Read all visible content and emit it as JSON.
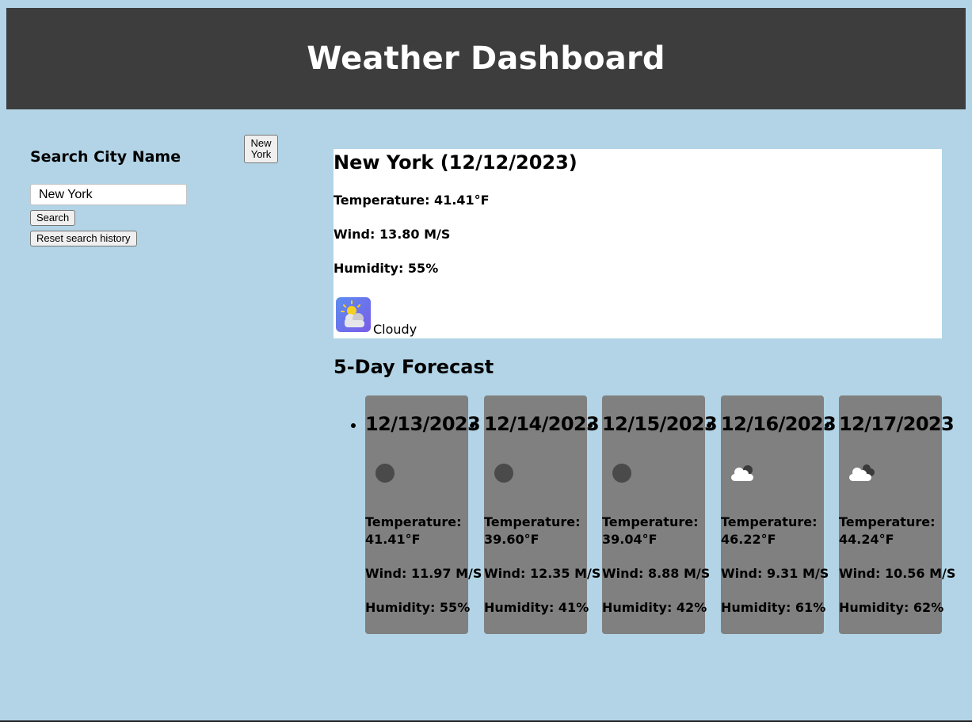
{
  "header": {
    "title": "Weather Dashboard"
  },
  "sidebar": {
    "title": "Search City Name",
    "history": [
      "New York"
    ],
    "input_value": "New York",
    "search_label": "Search",
    "reset_label": "Reset search history"
  },
  "current": {
    "heading": "New York (12/12/2023)",
    "temperature": "Temperature: 41.41°F",
    "wind": "Wind: 13.80 M/S",
    "humidity": "Humidity: 55%",
    "icon": "partly-cloudy-icon",
    "description": "Cloudy"
  },
  "forecast": {
    "title": "5-Day Forecast",
    "days": [
      {
        "date": "12/13/2023",
        "icon": "dark-circle-icon",
        "temp_label": "Temperature:",
        "temp_value": "41.41°F",
        "wind": "Wind: 11.97 M/S",
        "humidity": "Humidity: 55%"
      },
      {
        "date": "12/14/2023",
        "icon": "dark-circle-icon",
        "temp_label": "Temperature:",
        "temp_value": "39.60°F",
        "wind": "Wind: 12.35 M/S",
        "humidity": "Humidity: 41%"
      },
      {
        "date": "12/15/2023",
        "icon": "dark-circle-icon",
        "temp_label": "Temperature:",
        "temp_value": "39.04°F",
        "wind": "Wind: 8.88 M/S",
        "humidity": "Humidity: 42%"
      },
      {
        "date": "12/16/2023",
        "icon": "cloud-icon",
        "temp_label": "Temperature:",
        "temp_value": "46.22°F",
        "wind": "Wind: 9.31 M/S",
        "humidity": "Humidity: 61%"
      },
      {
        "date": "12/17/2023",
        "icon": "cloud-icon",
        "temp_label": "Temperature:",
        "temp_value": "44.24°F",
        "wind": "Wind: 10.56 M/S",
        "humidity": "Humidity: 62%"
      }
    ]
  },
  "colors": {
    "page_bg": "#b2d4e6",
    "header_bg": "#3d3d3d",
    "card_bg": "#808080"
  }
}
